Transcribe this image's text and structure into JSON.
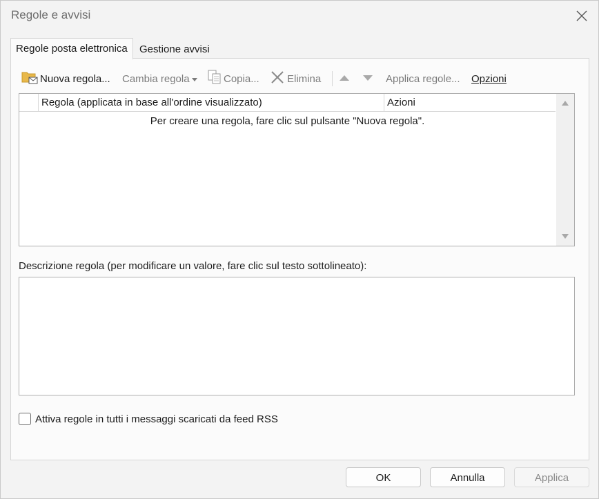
{
  "window": {
    "title": "Regole e avvisi"
  },
  "tabs": [
    {
      "label": "Regole posta elettronica",
      "active": true
    },
    {
      "label": "Gestione avvisi",
      "active": false
    }
  ],
  "toolbar": {
    "new_rule": "Nuova regola...",
    "change_rule": "Cambia regola",
    "copy": "Copia...",
    "delete": "Elimina",
    "apply_rules": "Applica regole...",
    "options": "Opzioni"
  },
  "rules_list": {
    "columns": [
      "Regola (applicata in base all'ordine visualizzato)",
      "Azioni"
    ],
    "empty_message": "Per creare una regola, fare clic sul pulsante \"Nuova regola\"."
  },
  "description": {
    "label": "Descrizione regola (per modificare un valore, fare clic sul testo sottolineato):"
  },
  "rss_checkbox": {
    "label": "Attiva regole in tutti i messaggi scaricati da feed RSS",
    "checked": false
  },
  "buttons": {
    "ok": "OK",
    "cancel": "Annulla",
    "apply": "Applica"
  },
  "icons": {
    "close": "close-icon",
    "new_rule": "folder-envelope-icon",
    "change_rule_dropdown": "chevron-down-icon",
    "copy": "copy-icon",
    "delete": "x-icon",
    "move_up": "triangle-up-icon",
    "move_down": "triangle-down-icon"
  }
}
